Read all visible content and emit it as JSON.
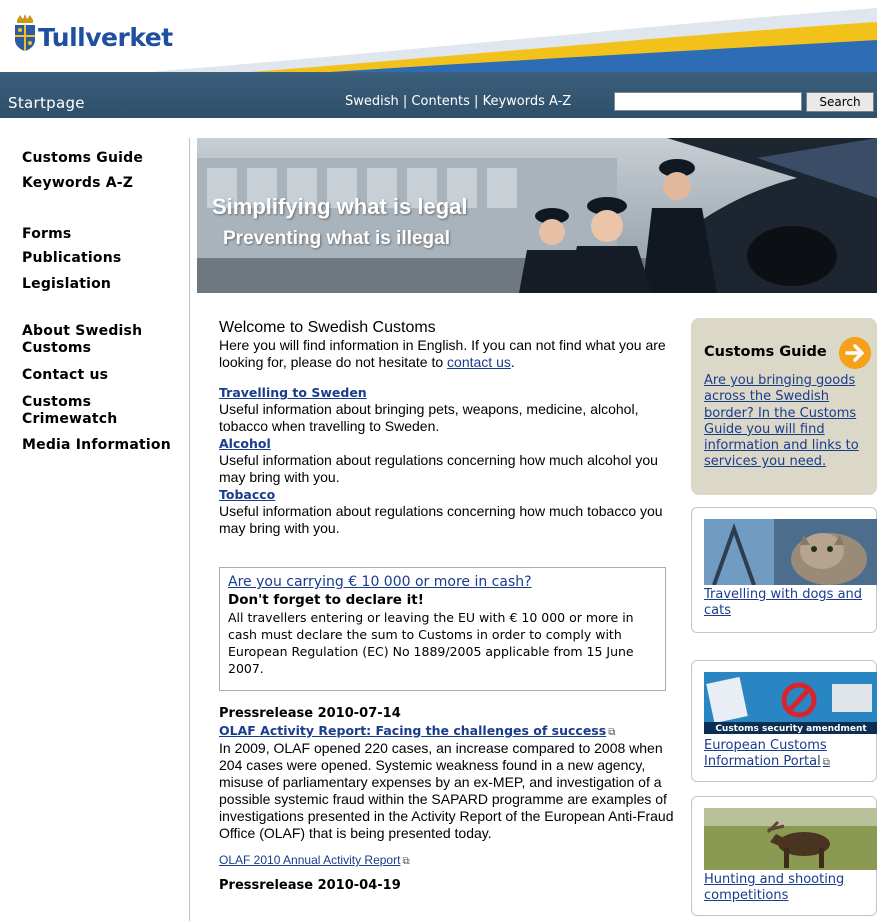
{
  "brand": {
    "name": "Tullverket",
    "logo_icon": "royal-crest-icon"
  },
  "navbar": {
    "startpage": "Startpage",
    "links": [
      "Swedish",
      "Contents",
      "Keywords A-Z"
    ],
    "separator": " | ",
    "search_placeholder": "",
    "search_button": "Search"
  },
  "leftnav": {
    "items": [
      "Customs Guide",
      "Keywords A-Z",
      "Forms",
      "Publications",
      "Legislation",
      "About Swedish Customs",
      "Contact us",
      "Customs Crimewatch",
      "Media Information"
    ]
  },
  "hero": {
    "line1": "Simplifying what is legal",
    "line2": "Preventing what is illegal"
  },
  "main": {
    "welcome_title": "Welcome to Swedish Customs",
    "welcome_text": "Here you will find information in English. If you can not find what you are looking for, please do not hesitate to ",
    "welcome_link": "contact us",
    "welcome_end": ".",
    "sections": [
      {
        "title": "Travelling to Sweden",
        "text": "Useful information about bringing pets, weapons, medicine, alcohol, tobacco when travelling to Sweden."
      },
      {
        "title": "Alcohol",
        "text": "Useful information about regulations concerning how much alcohol you may bring with you."
      },
      {
        "title": "Tobacco",
        "text": "Useful information about regulations concerning how much tobacco you may bring with you."
      }
    ]
  },
  "cash": {
    "title": "Are you carrying € 10 000 or more in cash?",
    "subtitle": "Don't forget to declare it!",
    "text": "All travellers entering or leaving the EU with € 10 000 or more in cash must declare the sum to Customs in order to comply with European Regulation (EC) No 1889/2005 applicable from 15 June 2007."
  },
  "press": {
    "items": [
      {
        "date": "Pressrelease 2010-07-14",
        "link": "OLAF Activity Report: Facing the challenges of success",
        "text": "In 2009, OLAF opened 220 cases, an increase compared to 2008 when 204 cases were opened. Systemic weakness found in a new agency, misuse of parliamentary expenses by an ex-MEP, and investigation of a possible systemic fraud within the SAPARD programme are examples of investigations presented in the Activity Report of the European Anti-Fraud Office (OLAF) that is being presented today.",
        "report_link": "OLAF 2010 Annual Activity Report"
      }
    ],
    "next_date": "Pressrelease 2010-04-19"
  },
  "guide": {
    "title": "Customs Guide",
    "text": "Are you bringing goods across the Swedish border? In the Customs Guide you will find information and links to services you need."
  },
  "promos": [
    {
      "link": "Travelling with dogs and cats"
    },
    {
      "image_caption": "Customs security amendment",
      "link": "European Customs Information Portal"
    },
    {
      "link": "Hunting and shooting competitions"
    }
  ],
  "colors": {
    "navbar": "#3b5f7c",
    "link": "#1a3c8c",
    "guide_box": "#dcd8c8",
    "accent": "#f5a11a"
  }
}
